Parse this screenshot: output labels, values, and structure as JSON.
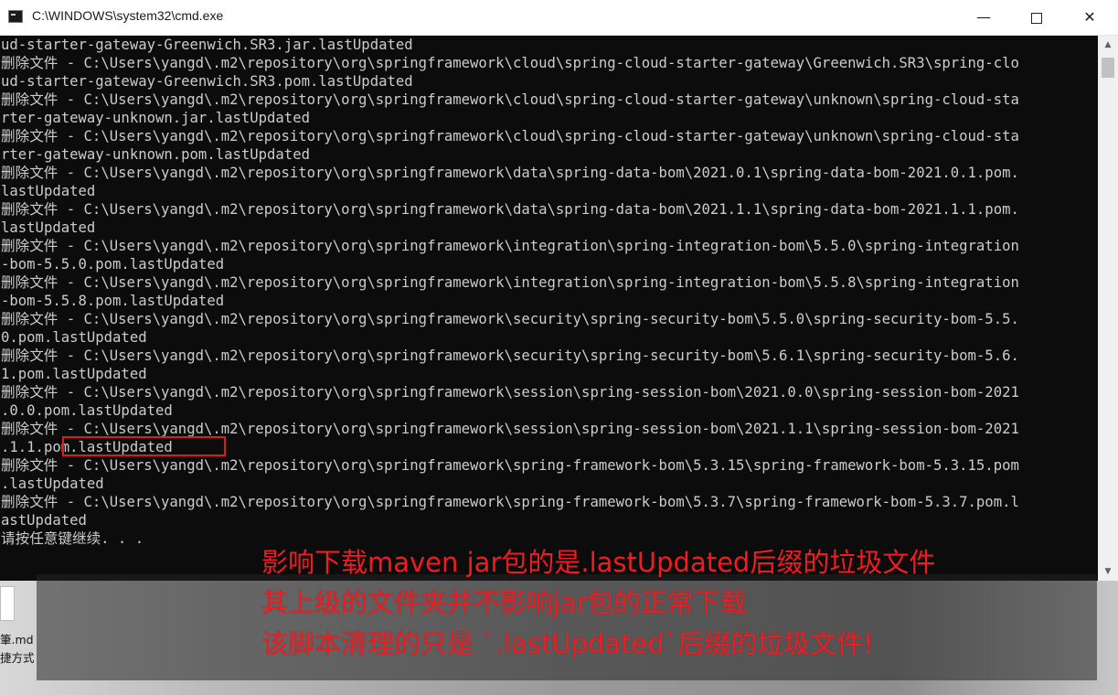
{
  "window": {
    "title": "C:\\WINDOWS\\system32\\cmd.exe",
    "min_glyph": "—",
    "close_glyph": "✕",
    "icon": "console-icon"
  },
  "console": {
    "lines": [
      "ud-starter-gateway-Greenwich.SR3.jar.lastUpdated",
      "删除文件 - C:\\Users\\yangd\\.m2\\repository\\org\\springframework\\cloud\\spring-cloud-starter-gateway\\Greenwich.SR3\\spring-clo",
      "ud-starter-gateway-Greenwich.SR3.pom.lastUpdated",
      "删除文件 - C:\\Users\\yangd\\.m2\\repository\\org\\springframework\\cloud\\spring-cloud-starter-gateway\\unknown\\spring-cloud-sta",
      "rter-gateway-unknown.jar.lastUpdated",
      "删除文件 - C:\\Users\\yangd\\.m2\\repository\\org\\springframework\\cloud\\spring-cloud-starter-gateway\\unknown\\spring-cloud-sta",
      "rter-gateway-unknown.pom.lastUpdated",
      "删除文件 - C:\\Users\\yangd\\.m2\\repository\\org\\springframework\\data\\spring-data-bom\\2021.0.1\\spring-data-bom-2021.0.1.pom.",
      "lastUpdated",
      "删除文件 - C:\\Users\\yangd\\.m2\\repository\\org\\springframework\\data\\spring-data-bom\\2021.1.1\\spring-data-bom-2021.1.1.pom.",
      "lastUpdated",
      "删除文件 - C:\\Users\\yangd\\.m2\\repository\\org\\springframework\\integration\\spring-integration-bom\\5.5.0\\spring-integration",
      "-bom-5.5.0.pom.lastUpdated",
      "删除文件 - C:\\Users\\yangd\\.m2\\repository\\org\\springframework\\integration\\spring-integration-bom\\5.5.8\\spring-integration",
      "-bom-5.5.8.pom.lastUpdated",
      "删除文件 - C:\\Users\\yangd\\.m2\\repository\\org\\springframework\\security\\spring-security-bom\\5.5.0\\spring-security-bom-5.5.",
      "0.pom.lastUpdated",
      "删除文件 - C:\\Users\\yangd\\.m2\\repository\\org\\springframework\\security\\spring-security-bom\\5.6.1\\spring-security-bom-5.6.",
      "1.pom.lastUpdated",
      "删除文件 - C:\\Users\\yangd\\.m2\\repository\\org\\springframework\\session\\spring-session-bom\\2021.0.0\\spring-session-bom-2021",
      ".0.0.pom.lastUpdated",
      "删除文件 - C:\\Users\\yangd\\.m2\\repository\\org\\springframework\\session\\spring-session-bom\\2021.1.1\\spring-session-bom-2021",
      ".1.1.pom.lastUpdated",
      "删除文件 - C:\\Users\\yangd\\.m2\\repository\\org\\springframework\\spring-framework-bom\\5.3.15\\spring-framework-bom-5.3.15.pom",
      ".lastUpdated",
      "删除文件 - C:\\Users\\yangd\\.m2\\repository\\org\\springframework\\spring-framework-bom\\5.3.7\\spring-framework-bom-5.3.7.pom.l",
      "astUpdated",
      "请按任意键继续. . ."
    ]
  },
  "desktop": {
    "file_label_line1": "筆.md",
    "file_label_line2": "捷方式"
  },
  "annotations": {
    "line1": "影响下载maven jar包的是.lastUpdated后缀的垃圾文件",
    "line2": "其上级的文件夹并不影响jar包的正常下载",
    "line3": "该脚本清理的只是 `.lastUpdated`后缀的垃圾文件!",
    "color": "#f01c22"
  }
}
